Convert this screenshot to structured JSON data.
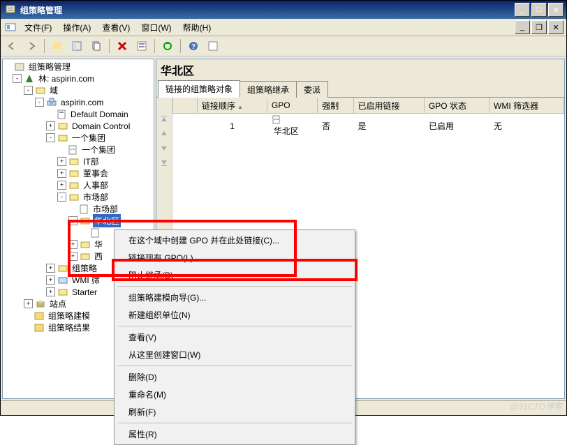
{
  "window": {
    "title": "组策略管理"
  },
  "menubar": {
    "file": "文件(F)",
    "action": "操作(A)",
    "view": "查看(V)",
    "window": "窗口(W)",
    "help": "帮助(H)"
  },
  "tree": {
    "root": "组策略管理",
    "forest": "林: aspirin.com",
    "domains": "域",
    "domain": "aspirin.com",
    "default_policy": "Default Domain",
    "domain_controllers": "Domain Control",
    "group": "一个集团",
    "group_child": "一个集团",
    "it": "IT部",
    "board": "董事会",
    "hr": "人事部",
    "marketing": "市场部",
    "marketing_child": "市场部",
    "north": "华北区",
    "east": "华",
    "west": "西",
    "gpo_objects": "组策略",
    "wmi": "WMI 筛",
    "starter": "Starter",
    "sites": "站点",
    "modeling": "组策略建模",
    "results": "组策略结果"
  },
  "heading": "华北区",
  "tabs": {
    "linked": "链接的组策略对象",
    "inherit": "组策略继承",
    "deleg": "委派"
  },
  "table": {
    "headers": {
      "order": "链接顺序",
      "gpo": "GPO",
      "enforced": "强制",
      "link_en": "已启用链接",
      "status": "GPO 状态",
      "wmi": "WMI 筛选器"
    },
    "rows": [
      {
        "order": "1",
        "gpo": "华北区",
        "enforced": "否",
        "link_en": "是",
        "status": "已启用",
        "wmi": "无"
      }
    ]
  },
  "context_menu": {
    "create_link": "在这个域中创建 GPO 并在此处链接(C)...",
    "link_existing": "链接现有 GPO(L)...",
    "block_inherit": "阻止继承(B)",
    "modeling": "组策略建模向导(G)...",
    "new_ou": "新建组织单位(N)",
    "view": "查看(V)",
    "new_window": "从这里创建窗口(W)",
    "delete": "删除(D)",
    "rename": "重命名(M)",
    "refresh": "刷新(F)",
    "properties": "属性(R)"
  },
  "watermark": "@51CTO博客"
}
